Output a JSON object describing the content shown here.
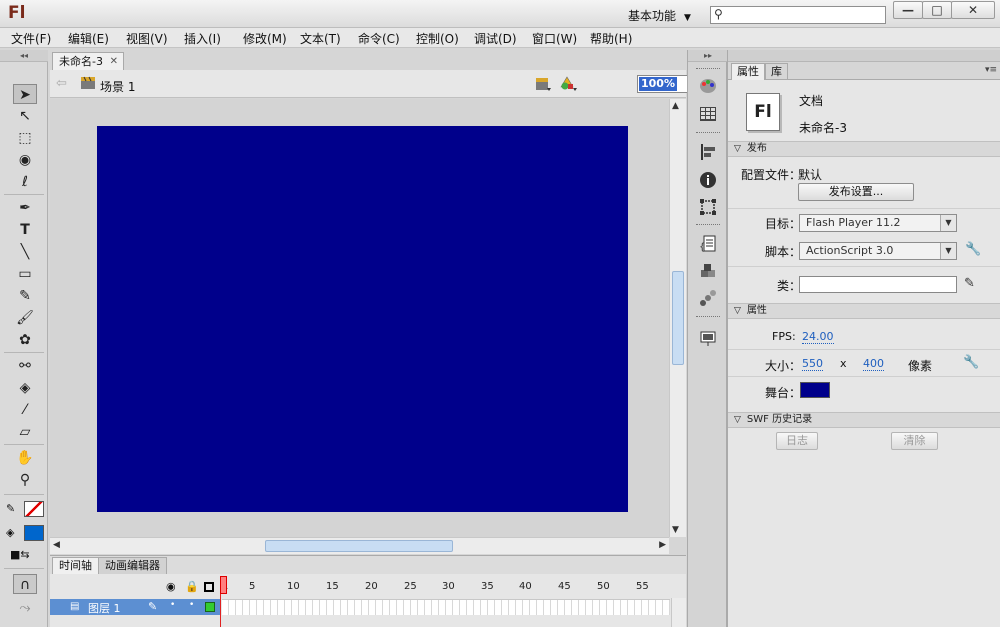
{
  "app": {
    "logo": "Fl",
    "workspace_label": "基本功能",
    "window_buttons": {
      "minimize": "—",
      "maximize": "□",
      "close": "✕"
    }
  },
  "menu": [
    "文件(F)",
    "编辑(E)",
    "视图(V)",
    "插入(I)",
    "修改(M)",
    "文本(T)",
    "命令(C)",
    "控制(O)",
    "调试(D)",
    "窗口(W)",
    "帮助(H)"
  ],
  "document": {
    "tab_title": "未命名-3",
    "scene": "场景 1",
    "zoom": "100%",
    "stage_color": "#00008b"
  },
  "timeline": {
    "tabs": [
      "时间轴",
      "动画编辑器"
    ],
    "frame_numbers": [
      "1",
      "5",
      "10",
      "15",
      "20",
      "25",
      "30",
      "35",
      "40",
      "45",
      "50",
      "55"
    ],
    "layer_name": "图层 1"
  },
  "properties": {
    "tabs": [
      "属性",
      "库"
    ],
    "doc_icon": "Fl",
    "doc_type": "文档",
    "doc_name": "未命名-3",
    "publish": {
      "section": "发布",
      "profile_label": "配置文件：",
      "profile_value": "默认",
      "settings_button": "发布设置..."
    },
    "target_label": "目标：",
    "target_value": "Flash Player 11.2",
    "script_label": "脚本：",
    "script_value": "ActionScript 3.0",
    "class_label": "类：",
    "props_section": "属性",
    "fps_label": "FPS:",
    "fps_value": "24.00",
    "size_label": "大小：",
    "width": "550",
    "x_sep": "x",
    "height": "400",
    "unit": "像素",
    "stage_label": "舞台：",
    "swf_section": "SWF 历史记录",
    "log_button": "日志",
    "clear_button": "清除"
  }
}
